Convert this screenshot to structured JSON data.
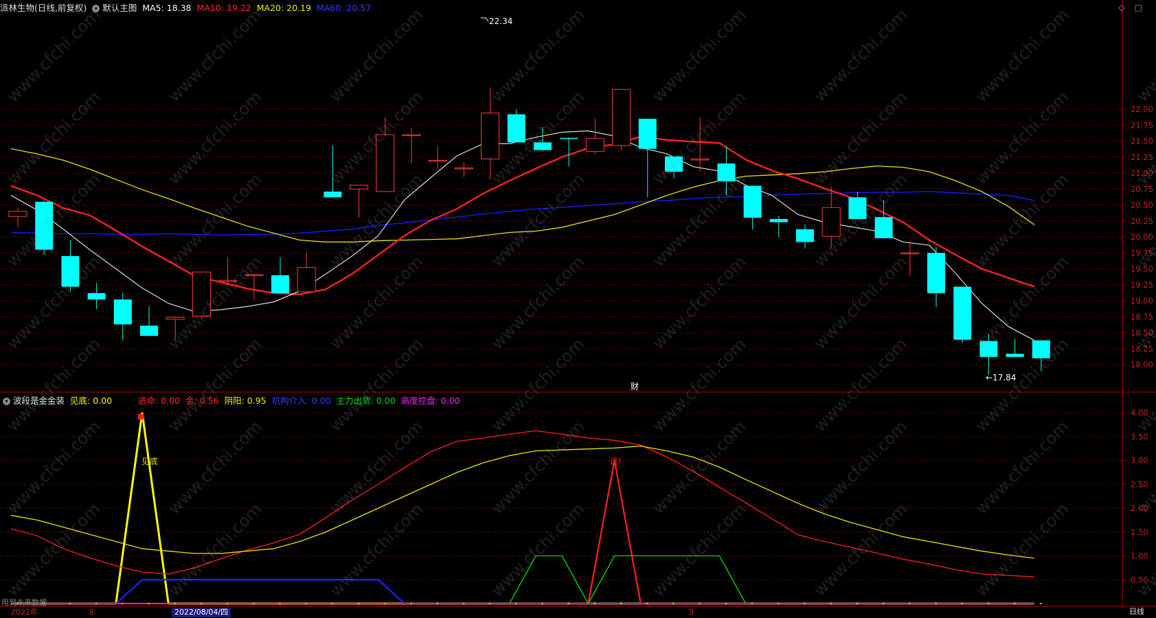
{
  "colors": {
    "up": "#ff3b3b",
    "down": "#00ffff",
    "ma5": "#dddddd",
    "ma10": "#ff2020",
    "ma20": "#e6e600",
    "ma60": "#1a1aff",
    "grid": "#7a0000",
    "axis_text": "#cc2020"
  },
  "main_header": {
    "symbol": "派林生物(日线,前复权)",
    "chart_name": "默认主图",
    "ma5": "MA5: 18.38",
    "ma10": "MA10: 19.22",
    "ma20": "MA20: 20.19",
    "ma60": "MA60: 20.57"
  },
  "sub_header": {
    "indicator_name": "波段是金金装",
    "jiandi": "见底: 0.00",
    "taoming": "逃命: 0.00",
    "jin": "金: 0.56",
    "yinyang": "阴阳: 0.95",
    "jigou": "机构介入: 0.00",
    "zhuli": "主力出货: 0.00",
    "gaodu": "高度控盘: 0.00"
  },
  "annotations": {
    "high": "22.34",
    "low": "17.84",
    "cai": "财",
    "jiandi_label": "见底",
    "tao_label": "逃!"
  },
  "bottom_bar": {
    "year": "2022年",
    "month8": "8",
    "date": "2022/08/04/四",
    "month9": "9",
    "period": "日线",
    "corner_text": "用到未来数据"
  },
  "watermark": "www.cfchi.com",
  "chart_data": [
    {
      "type": "candlestick",
      "ylim": [
        17.7,
        22.5
      ],
      "y_ticks": [
        "22.00",
        "21.75",
        "21.50",
        "21.25",
        "21.00",
        "20.75",
        "20.50",
        "20.25",
        "20.00",
        "19.75",
        "19.50",
        "19.25",
        "19.00",
        "18.75",
        "18.50",
        "18.25",
        "18.00"
      ],
      "ohlc": [
        [
          20.32,
          20.45,
          20.15,
          20.4
        ],
        [
          20.55,
          20.57,
          19.72,
          19.8
        ],
        [
          19.7,
          19.95,
          19.15,
          19.22
        ],
        [
          19.12,
          19.28,
          18.87,
          19.02
        ],
        [
          19.02,
          19.13,
          18.38,
          18.63
        ],
        [
          18.61,
          18.91,
          18.45,
          18.45
        ],
        [
          18.71,
          18.75,
          18.39,
          18.74
        ],
        [
          18.76,
          19.46,
          18.71,
          19.45
        ],
        [
          19.3,
          19.68,
          19.25,
          19.32
        ],
        [
          19.4,
          19.43,
          19.02,
          19.41
        ],
        [
          19.4,
          19.68,
          19.11,
          19.12
        ],
        [
          19.14,
          19.75,
          19.11,
          19.52
        ],
        [
          20.71,
          21.43,
          20.63,
          20.62
        ],
        [
          20.75,
          20.79,
          20.3,
          20.81
        ],
        [
          20.71,
          21.87,
          20.71,
          21.6
        ],
        [
          21.6,
          21.71,
          21.15,
          21.6
        ],
        [
          21.2,
          21.43,
          21.06,
          21.2
        ],
        [
          21.08,
          21.17,
          20.94,
          21.08
        ],
        [
          21.22,
          22.34,
          20.9,
          21.94
        ],
        [
          21.92,
          22,
          21.48,
          21.48
        ],
        [
          21.48,
          21.72,
          21.34,
          21.36
        ],
        [
          21.55,
          21.56,
          21.1,
          21.54
        ],
        [
          21.34,
          21.85,
          21.3,
          21.54
        ],
        [
          21.43,
          22.31,
          21.36,
          22.31
        ],
        [
          21.85,
          21.85,
          20.62,
          21.38
        ],
        [
          21.26,
          21.26,
          20.92,
          21.02
        ],
        [
          21.22,
          21.87,
          21.03,
          21.22
        ],
        [
          21.15,
          21.42,
          20.65,
          20.87
        ],
        [
          20.8,
          20.81,
          20.12,
          20.3
        ],
        [
          20.28,
          20.33,
          20,
          20.23
        ],
        [
          20.12,
          20.2,
          19.82,
          19.92
        ],
        [
          20.01,
          20.78,
          19.83,
          20.46
        ],
        [
          20.62,
          20.71,
          20.28,
          20.28
        ],
        [
          20.31,
          20.58,
          19.98,
          19.98
        ],
        [
          19.75,
          19.94,
          19.39,
          19.75
        ],
        [
          19.75,
          19.84,
          18.9,
          19.12
        ],
        [
          19.22,
          19.22,
          18.34,
          18.39
        ],
        [
          18.37,
          18.48,
          17.84,
          18.12
        ],
        [
          18.17,
          18.4,
          18.12,
          18.12
        ],
        [
          18.38,
          18.38,
          17.9,
          18.1
        ]
      ],
      "ma5": [
        20.65,
        20.42,
        20.12,
        19.8,
        19.5,
        19.2,
        18.96,
        18.83,
        18.86,
        18.91,
        18.98,
        19.15,
        19.42,
        19.7,
        20.02,
        20.58,
        20.93,
        21.27,
        21.46,
        21.46,
        21.56,
        21.64,
        21.66,
        21.58,
        21.4,
        21.3,
        21.1,
        21.03,
        20.81,
        20.65,
        20.35,
        20.23,
        20.16,
        20.09,
        19.92,
        19.87,
        19.43,
        18.96,
        18.6,
        18.38
      ],
      "ma10": [
        20.8,
        20.65,
        20.45,
        20.34,
        20.1,
        19.85,
        19.62,
        19.39,
        19.29,
        19.19,
        19.12,
        19.1,
        19.18,
        19.42,
        19.72,
        20.02,
        20.26,
        20.44,
        20.68,
        20.88,
        21.07,
        21.25,
        21.39,
        21.45,
        21.57,
        21.52,
        21.49,
        21.47,
        21.21,
        21.04,
        20.91,
        20.76,
        20.62,
        20.43,
        20.23,
        19.95,
        19.72,
        19.5,
        19.36,
        19.22
      ],
      "ma20": [
        21.38,
        21.3,
        21.2,
        21.06,
        20.9,
        20.74,
        20.6,
        20.45,
        20.31,
        20.17,
        20.06,
        19.95,
        19.92,
        19.92,
        19.94,
        19.95,
        19.96,
        19.97,
        20.02,
        20.07,
        20.09,
        20.15,
        20.25,
        20.35,
        20.5,
        20.65,
        20.78,
        20.88,
        20.95,
        20.97,
        20.99,
        21.02,
        21.07,
        21.11,
        21.09,
        21.02,
        20.88,
        20.71,
        20.48,
        20.19
      ],
      "ma60": [
        20.07,
        20.06,
        20.05,
        20.05,
        20.04,
        20.04,
        20.05,
        20.04,
        20.03,
        20.04,
        20.04,
        20.06,
        20.09,
        20.12,
        20.18,
        20.22,
        20.27,
        20.31,
        20.36,
        20.4,
        20.44,
        20.46,
        20.49,
        20.52,
        20.55,
        20.57,
        20.6,
        20.62,
        20.63,
        20.65,
        20.67,
        20.68,
        20.69,
        20.7,
        20.7,
        20.71,
        20.69,
        20.67,
        20.65,
        20.57
      ]
    },
    {
      "type": "line",
      "ylim": [
        0,
        4.2
      ],
      "y_ticks": [
        "4.00",
        "3.50",
        "3.00",
        "2.50",
        "2.00",
        "1.50",
        "1.00",
        "0.50"
      ],
      "series": [
        {
          "name": "见底",
          "color": "#ffff00",
          "values": [
            0,
            0,
            0,
            0,
            0,
            4.0,
            0,
            0,
            0,
            0,
            0,
            0,
            0,
            0,
            0,
            0,
            0,
            0,
            0,
            0,
            0,
            0,
            0,
            0,
            0,
            0,
            0,
            0,
            0,
            0,
            0,
            0,
            0,
            0,
            0,
            0,
            0,
            0,
            0,
            0
          ]
        },
        {
          "name": "逃命",
          "color": "#ff2020",
          "values": [
            0,
            0,
            0,
            0,
            0,
            0,
            0,
            0,
            0,
            0,
            0,
            0,
            0,
            0,
            0,
            0,
            0,
            0,
            0,
            0,
            0,
            0,
            0,
            3.0,
            0,
            0,
            0,
            0,
            0,
            0,
            0,
            0,
            0,
            0,
            0,
            0,
            0,
            0,
            0,
            0
          ]
        },
        {
          "name": "金",
          "color": "#ff2020",
          "values": [
            1.57,
            1.42,
            1.15,
            0.96,
            0.79,
            0.66,
            0.62,
            0.75,
            0.94,
            1.12,
            1.27,
            1.45,
            1.8,
            2.17,
            2.5,
            2.85,
            3.18,
            3.4,
            3.47,
            3.55,
            3.62,
            3.55,
            3.47,
            3.42,
            3.32,
            3.07,
            2.77,
            2.44,
            2.11,
            1.78,
            1.44,
            1.3,
            1.18,
            1.06,
            0.93,
            0.83,
            0.71,
            0.62,
            0.59,
            0.56
          ]
        },
        {
          "name": "阴阳",
          "color": "#e6e600",
          "values": [
            1.85,
            1.75,
            1.6,
            1.45,
            1.3,
            1.15,
            1.1,
            1.05,
            1.05,
            1.1,
            1.15,
            1.3,
            1.5,
            1.75,
            2.0,
            2.25,
            2.5,
            2.75,
            2.95,
            3.1,
            3.2,
            3.22,
            3.24,
            3.26,
            3.3,
            3.2,
            3.07,
            2.86,
            2.6,
            2.35,
            2.1,
            1.88,
            1.7,
            1.55,
            1.4,
            1.3,
            1.2,
            1.1,
            1.02,
            0.95
          ]
        },
        {
          "name": "机构介入",
          "color": "#2020ff",
          "values": [
            0,
            0,
            0,
            0,
            0,
            0.5,
            0.5,
            0.5,
            0.5,
            0.5,
            0.5,
            0.5,
            0.5,
            0.5,
            0.5,
            0,
            0,
            0,
            0,
            0,
            0,
            0,
            0,
            0,
            0,
            0,
            0,
            0,
            0,
            0,
            0,
            0,
            0,
            0,
            0,
            0,
            0,
            0,
            0,
            0
          ]
        },
        {
          "name": "主力出货",
          "color": "#00e000",
          "values": [
            0,
            0,
            0,
            0,
            0,
            0,
            0,
            0,
            0,
            0,
            0,
            0,
            0,
            0,
            0,
            0,
            0,
            0,
            0,
            0,
            1.0,
            1.0,
            0,
            1.0,
            1.0,
            1.0,
            1.0,
            1.0,
            0,
            0,
            0,
            0,
            0,
            0,
            0,
            0,
            0,
            0,
            0,
            0
          ]
        },
        {
          "name": "高度控盘",
          "color": "#ff00ff",
          "values": [
            0,
            0,
            0,
            0,
            0,
            0,
            0,
            0,
            0,
            0,
            0,
            0,
            0,
            0,
            0,
            0,
            0,
            0,
            0,
            0,
            0,
            0,
            0,
            0,
            0,
            0,
            0,
            0,
            0,
            0,
            0,
            0,
            0,
            0,
            0,
            0,
            0,
            0,
            0,
            0
          ]
        }
      ]
    }
  ]
}
